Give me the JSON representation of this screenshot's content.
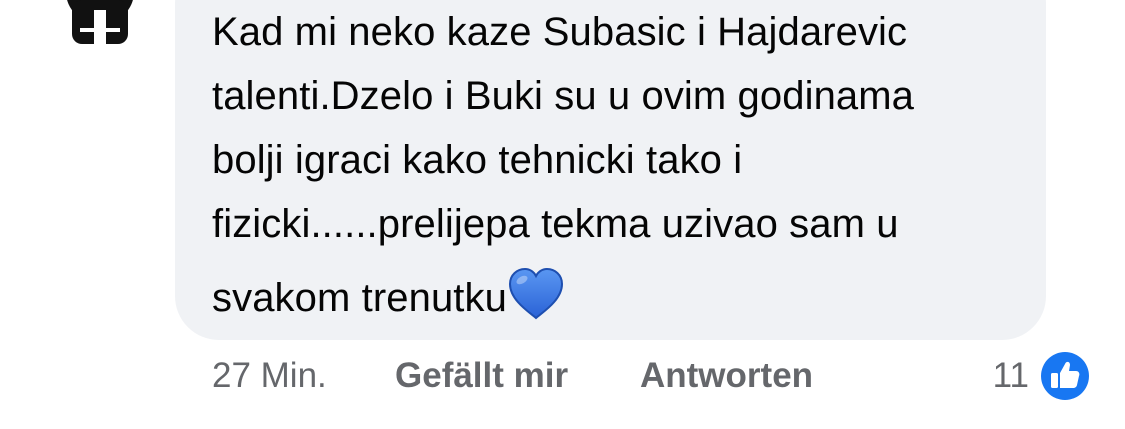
{
  "comment": {
    "lines": [
      "Kad mi neko kaze Subasic i Hajdarevic",
      "talenti.Dzelo i Buki su u ovim godinama",
      "bolji igraci kako tehnicki tako i",
      "fizicki......prelijepa tekma uzivao sam u",
      "svakom trenutku"
    ],
    "emoji": "blue-heart-icon"
  },
  "actions": {
    "timestamp": "27 Min.",
    "like_label": "Gefällt mir",
    "reply_label": "Antworten",
    "reaction_count": "11",
    "reaction_icon": "like-thumb-icon",
    "reaction_color": "#1877f2"
  },
  "colors": {
    "bubble": "#f0f2f5",
    "text": "#050505",
    "secondary_text": "#65676b",
    "heart": "#3d7be6"
  }
}
